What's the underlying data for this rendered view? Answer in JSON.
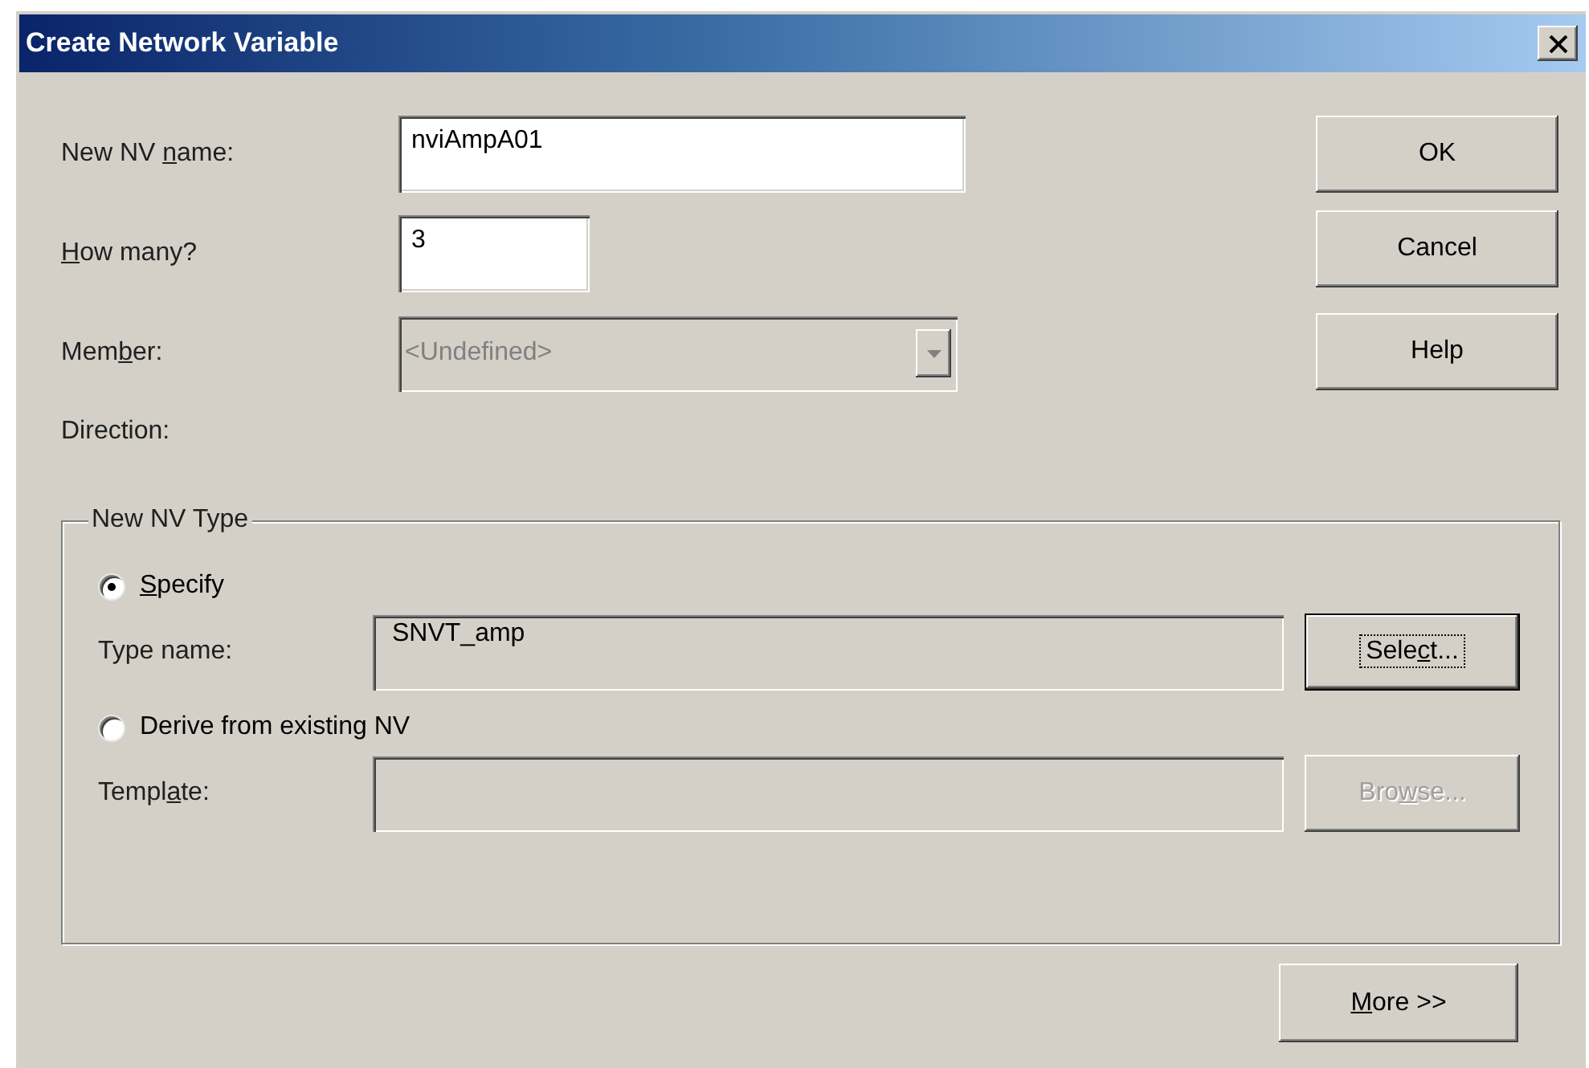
{
  "window": {
    "title": "Create Network Variable"
  },
  "fields": [
    {
      "kind": "text",
      "label": [
        {
          "text": "New NV ",
          "underlined": false
        },
        {
          "text": "n",
          "underlined": true
        },
        {
          "text": "ame:",
          "underlined": false
        }
      ],
      "value": "nviAmpA01"
    },
    {
      "kind": "text",
      "label": [
        {
          "text": "H",
          "underlined": true
        },
        {
          "text": "ow many?",
          "underlined": false
        }
      ],
      "value": "3"
    },
    {
      "kind": "combo",
      "label": [
        {
          "text": "Mem",
          "underlined": false
        },
        {
          "text": "b",
          "underlined": true
        },
        {
          "text": "er:",
          "underlined": false
        }
      ],
      "value": "<Undefined>",
      "disabled": true
    },
    {
      "kind": "plain",
      "label": [
        {
          "text": "Direction:",
          "underlined": false
        }
      ]
    }
  ],
  "buttons": [
    {
      "label": [
        {
          "text": "OK",
          "underlined": false
        }
      ]
    },
    {
      "label": [
        {
          "text": "Cancel",
          "underlined": false
        }
      ]
    },
    {
      "label": [
        {
          "text": "Help",
          "underlined": false
        }
      ]
    }
  ],
  "group": {
    "title": "New NV Type",
    "options": [
      {
        "label": [
          {
            "text": "S",
            "underlined": true
          },
          {
            "text": "pecify",
            "underlined": false
          }
        ],
        "selected": true,
        "field": {
          "label": [
            {
              "text": "Type name:",
              "underlined": false
            }
          ],
          "value": "SNVT_amp",
          "button": {
            "label": [
              {
                "text": "Sele",
                "underlined": false
              },
              {
                "text": "c",
                "underlined": true
              },
              {
                "text": "t...",
                "underlined": false
              }
            ],
            "focused": true,
            "disabled": false
          }
        }
      },
      {
        "label": [
          {
            "text": "Derive from existing NV",
            "underlined": false
          }
        ],
        "selected": false,
        "field": {
          "label": [
            {
              "text": "Templ",
              "underlined": false
            },
            {
              "text": "a",
              "underlined": true
            },
            {
              "text": "te:",
              "underlined": false
            }
          ],
          "button": {
            "label": [
              {
                "text": "Bro",
                "underlined": false
              },
              {
                "text": "w",
                "underlined": true
              },
              {
                "text": "se...",
                "underlined": false
              }
            ],
            "focused": false,
            "disabled": true
          }
        }
      }
    ]
  },
  "more_button": {
    "label": [
      {
        "text": "M",
        "underlined": true
      },
      {
        "text": "ore >>",
        "underlined": false
      }
    ]
  }
}
